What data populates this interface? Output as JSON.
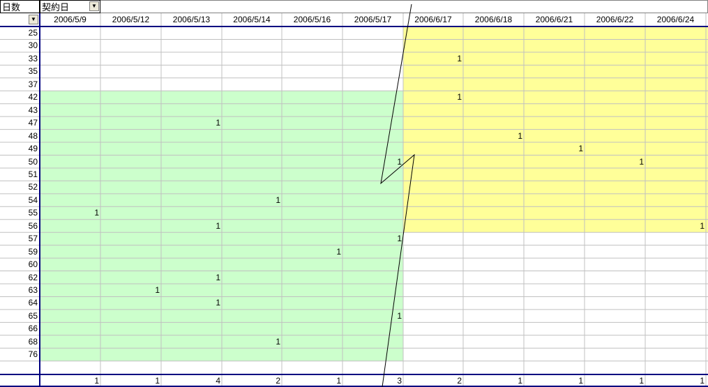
{
  "pivot": {
    "row_field": "日数",
    "column_field": "契約日",
    "filter_arrow": "▼",
    "columns": [
      "2006/5/9",
      "2006/5/12",
      "2006/5/13",
      "2006/5/14",
      "2006/5/16",
      "2006/5/17",
      "2006/6/17",
      "2006/6/18",
      "2006/6/21",
      "2006/6/22",
      "2006/6/24"
    ],
    "rows": [
      "25",
      "30",
      "33",
      "35",
      "37",
      "42",
      "43",
      "47",
      "48",
      "49",
      "50",
      "51",
      "52",
      "54",
      "55",
      "56",
      "57",
      "59",
      "60",
      "62",
      "63",
      "64",
      "65",
      "66",
      "68",
      "76"
    ],
    "values": [
      {
        "row": "33",
        "col": "2006/6/17",
        "value": "1"
      },
      {
        "row": "42",
        "col": "2006/6/17",
        "value": "1"
      },
      {
        "row": "47",
        "col": "2006/5/13",
        "value": "1"
      },
      {
        "row": "48",
        "col": "2006/6/18",
        "value": "1"
      },
      {
        "row": "49",
        "col": "2006/6/21",
        "value": "1"
      },
      {
        "row": "50",
        "col": "2006/5/17",
        "value": "1"
      },
      {
        "row": "50",
        "col": "2006/6/22",
        "value": "1"
      },
      {
        "row": "54",
        "col": "2006/5/14",
        "value": "1"
      },
      {
        "row": "55",
        "col": "2006/5/9",
        "value": "1"
      },
      {
        "row": "56",
        "col": "2006/5/13",
        "value": "1"
      },
      {
        "row": "56",
        "col": "2006/6/24",
        "value": "1"
      },
      {
        "row": "57",
        "col": "2006/5/17",
        "value": "1"
      },
      {
        "row": "59",
        "col": "2006/5/16",
        "value": "1"
      },
      {
        "row": "62",
        "col": "2006/5/13",
        "value": "1"
      },
      {
        "row": "63",
        "col": "2006/5/12",
        "value": "1"
      },
      {
        "row": "64",
        "col": "2006/5/13",
        "value": "1"
      },
      {
        "row": "65",
        "col": "2006/5/17",
        "value": "1"
      },
      {
        "row": "68",
        "col": "2006/5/14",
        "value": "1"
      }
    ],
    "totals": [
      "1",
      "1",
      "4",
      "2",
      "1",
      "3",
      "2",
      "1",
      "1",
      "1",
      "1"
    ]
  },
  "highlights": {
    "green": "#ccffcc",
    "yellow": "#ffff99",
    "gridline": "#c0c0c0",
    "frame": "#000080"
  }
}
